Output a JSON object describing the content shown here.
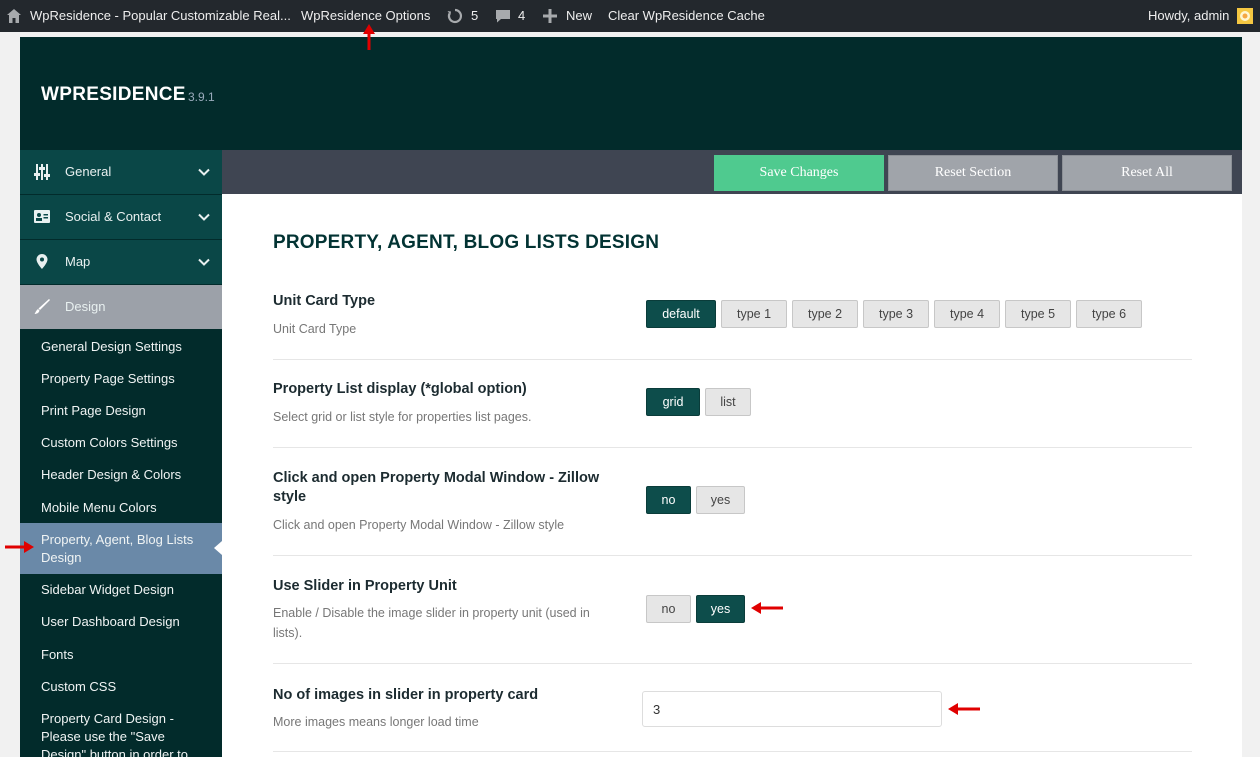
{
  "adminbar": {
    "site_name": "WpResidence - Popular Customizable Real...",
    "options_link": "WpResidence Options",
    "updates_count": "5",
    "comments_count": "4",
    "new_label": "New",
    "clear_cache_label": "Clear WpResidence Cache",
    "howdy": "Howdy, admin"
  },
  "header": {
    "brand": "WPRESIDENCE",
    "version": "3.9.1"
  },
  "sidebar": {
    "main_items": [
      {
        "label": "General"
      },
      {
        "label": "Social & Contact"
      },
      {
        "label": "Map"
      },
      {
        "label": "Design"
      }
    ],
    "sub_items": [
      {
        "label": "General Design Settings"
      },
      {
        "label": "Property Page Settings"
      },
      {
        "label": "Print Page Design"
      },
      {
        "label": "Custom Colors Settings"
      },
      {
        "label": "Header Design & Colors"
      },
      {
        "label": "Mobile Menu Colors"
      },
      {
        "label": "Property, Agent, Blog Lists Design"
      },
      {
        "label": "Sidebar Widget Design"
      },
      {
        "label": "User Dashboard Design"
      },
      {
        "label": "Fonts"
      },
      {
        "label": "Custom CSS"
      },
      {
        "label": "Property Card Design - Please use the \"Save Design\" button in order to save your"
      }
    ]
  },
  "toolbar": {
    "save_label": "Save Changes",
    "reset_section_label": "Reset Section",
    "reset_all_label": "Reset All"
  },
  "section": {
    "title": "PROPERTY, AGENT, BLOG LISTS DESIGN"
  },
  "options": {
    "unit_card": {
      "title": "Unit Card Type",
      "desc": "Unit Card Type",
      "choices": [
        "default",
        "type 1",
        "type 2",
        "type 3",
        "type 4",
        "type 5",
        "type 6"
      ],
      "selected": "default"
    },
    "list_display": {
      "title": "Property List display (*global option)",
      "desc": "Select grid or list style for properties list pages.",
      "choices": [
        "grid",
        "list"
      ],
      "selected": "grid"
    },
    "modal_window": {
      "title_line1": "Click and open Property Modal Window - Zillow",
      "title_line2": "style",
      "desc": "Click and open Property Modal Window - Zillow style",
      "choices": [
        "no",
        "yes"
      ],
      "selected": "no"
    },
    "slider": {
      "title": "Use Slider in Property Unit",
      "desc_line1": "Enable / Disable the image slider in property unit (used in",
      "desc_line2": "lists).",
      "choices": [
        "no",
        "yes"
      ],
      "selected": "yes"
    },
    "images_count": {
      "title": "No of images in slider in property card",
      "desc": "More images means longer load time",
      "value": "3"
    }
  },
  "colors": {
    "accent_dark": "#022b2b",
    "selected": "#0d4d4b",
    "save": "#4fca8f",
    "annotation_arrow": "#e00000"
  }
}
